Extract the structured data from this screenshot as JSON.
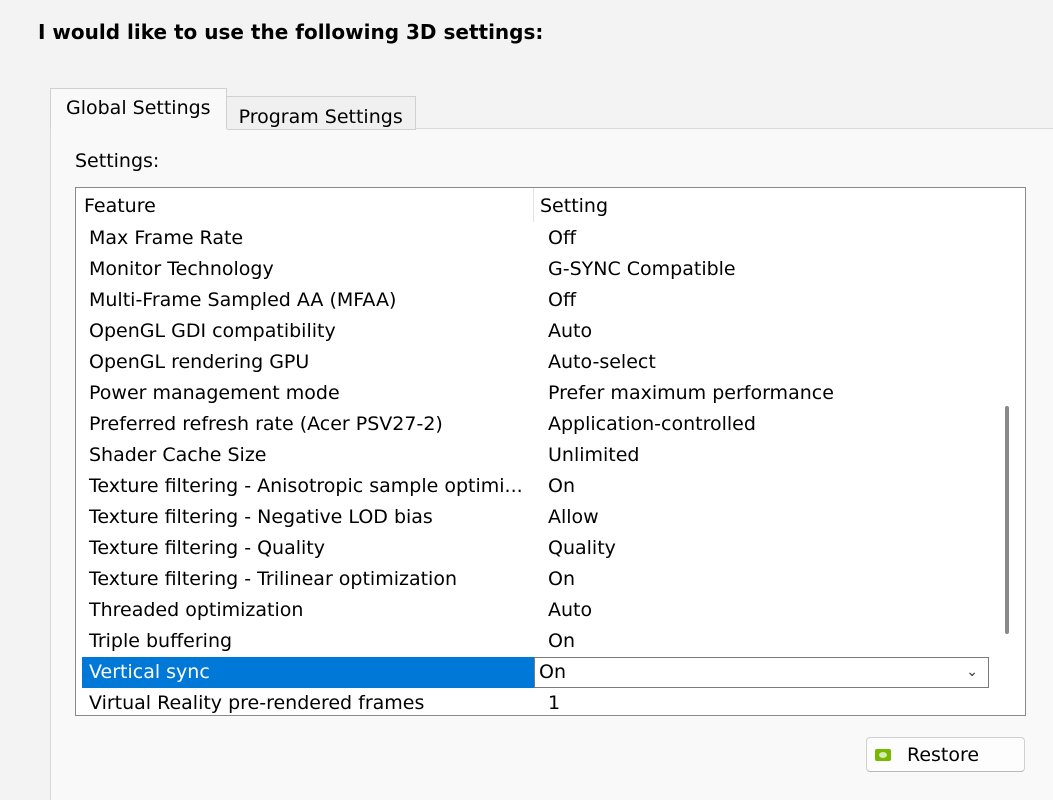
{
  "heading": "I would like to use the following 3D settings:",
  "tabs": [
    {
      "label": "Global Settings",
      "active": true
    },
    {
      "label": "Program Settings",
      "active": false
    }
  ],
  "settings_label": "Settings:",
  "list": {
    "columns": {
      "feature": "Feature",
      "setting": "Setting"
    },
    "rows": [
      {
        "feature": "Max Frame Rate",
        "setting": "Off"
      },
      {
        "feature": "Monitor Technology",
        "setting": "G-SYNC Compatible"
      },
      {
        "feature": "Multi-Frame Sampled AA (MFAA)",
        "setting": "Off"
      },
      {
        "feature": "OpenGL GDI compatibility",
        "setting": "Auto"
      },
      {
        "feature": "OpenGL rendering GPU",
        "setting": "Auto-select"
      },
      {
        "feature": "Power management mode",
        "setting": "Prefer maximum performance"
      },
      {
        "feature": "Preferred refresh rate (Acer PSV27-2)",
        "setting": "Application-controlled"
      },
      {
        "feature": "Shader Cache Size",
        "setting": "Unlimited"
      },
      {
        "feature": "Texture filtering - Anisotropic sample optimi...",
        "setting": "On"
      },
      {
        "feature": "Texture filtering - Negative LOD bias",
        "setting": "Allow"
      },
      {
        "feature": "Texture filtering - Quality",
        "setting": "Quality"
      },
      {
        "feature": "Texture filtering - Trilinear optimization",
        "setting": "On"
      },
      {
        "feature": "Threaded optimization",
        "setting": "Auto"
      },
      {
        "feature": "Triple buffering",
        "setting": "On"
      },
      {
        "feature": "Vertical sync",
        "setting": "On",
        "selected": true
      },
      {
        "feature": "Virtual Reality pre-rendered frames",
        "setting": "1"
      }
    ]
  },
  "restore_button": {
    "label": "Restore",
    "icon": "nvidia-icon"
  },
  "colors": {
    "selection": "#0078d7",
    "nvidia_green": "#76b900"
  }
}
